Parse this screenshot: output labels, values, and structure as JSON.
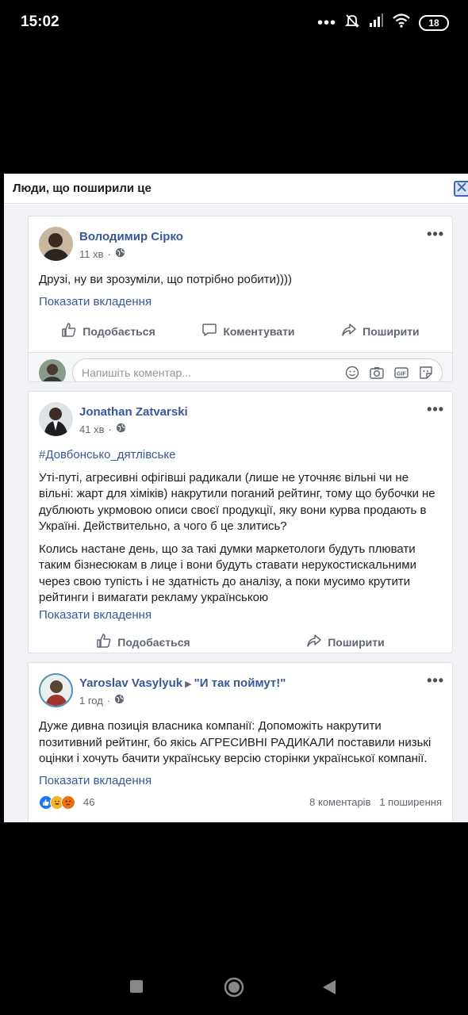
{
  "status_bar": {
    "time": "15:02",
    "dots": "•••",
    "battery": "18"
  },
  "dialog": {
    "title": "Люди, що поширили це"
  },
  "posts": [
    {
      "author": "Володимир Сірко",
      "time": "11 хв",
      "paragraphs": [
        "Друзі, ну ви зрозуміли, що потрібно робити))))"
      ],
      "show_attachment": "Показати вкладення",
      "actions": {
        "like": "Подобається",
        "comment": "Коментувати",
        "share": "Поширити"
      },
      "comment_placeholder": "Напишіть коментар..."
    },
    {
      "author": "Jonathan Zatvarski",
      "time": "41 хв",
      "hashtag": "#Довбонсько_дятлівське",
      "paragraphs": [
        "Уті-путі, агресивні офігівші радикали (лише не уточняє вільні чи не вільні: жарт для хіміків) накрутили поганий рейтинг, тому що бубочки не дублюють укрмовою описи своєї продукції, яку вони курва продають в Україні. Действительно, а чого б це злитись?",
        "Колись настане день, що за такі думки маркетологи будуть плювати таким бізнесюкам в лице і вони будуть ставати нерукостискальними через свою тупість і не здатність до аналізу, а поки мусимо крутити рейтинги і вимагати рекламу українською"
      ],
      "show_attachment": "Показати вкладення",
      "actions": {
        "like": "Подобається",
        "share": "Поширити"
      }
    },
    {
      "author": "Yaroslav Vasylyuk",
      "page": "\"И так поймут!\"",
      "time": "1 год",
      "paragraphs": [
        "Дуже дивна позиція власника компанії: Допоможіть накрутити позитивний рейтинг, бо якісь АГРЕСИВНІ РАДИКАЛИ поставили низькі оцінки і хочуть бачити українську версію сторінки української компанії."
      ],
      "show_attachment": "Показати вкладення",
      "reactions_count": "46",
      "comments_count": "8 коментарів",
      "shares_count": "1 поширення"
    }
  ],
  "colors": {
    "link": "#385898",
    "text": "#1c1e21",
    "muted": "#606770",
    "feed_bg": "#f0f2f5"
  },
  "icons": [
    "like-icon",
    "comment-icon",
    "share-icon",
    "globe-icon",
    "more-icon",
    "emoji-icon",
    "camera-icon",
    "gif-icon",
    "sticker-icon",
    "close-icon"
  ]
}
